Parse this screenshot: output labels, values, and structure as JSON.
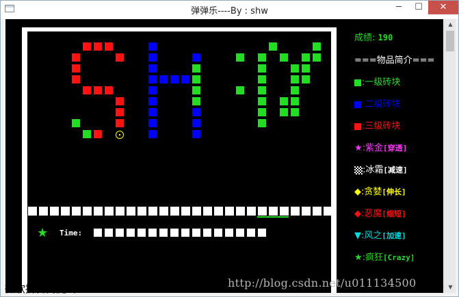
{
  "window": {
    "title": "弹弹乐----By : shw",
    "min_glyph": "─",
    "max_glyph": "☐",
    "close_glyph": "✕"
  },
  "game": {
    "brick_colors": {
      "level1": "#22dd22",
      "level2": "#0000ff",
      "level3": "#ff1111"
    },
    "time_label": "Time:",
    "time_star": "★"
  },
  "sidebar": {
    "score_label": "成绩:",
    "score_value": "190",
    "intro_title": "===物品简介===",
    "items": [
      {
        "icon": "green-square",
        "color": "#22dd22",
        "label": ":一级砖块"
      },
      {
        "icon": "blue-square",
        "color": "#0000ff",
        "label": ":二级砖块"
      },
      {
        "icon": "red-square",
        "color": "#ff1111",
        "label": ":三级砖块"
      },
      {
        "icon": "magenta-star",
        "glyph": "★",
        "color": "#ff33ff",
        "label": ":紫金",
        "tag": "[穿透]"
      },
      {
        "icon": "checker-square",
        "color": "#ffffff",
        "label": ":冰霜",
        "tag": "[减速]"
      },
      {
        "icon": "yellow-diamond",
        "glyph": "◆",
        "color": "#ffff00",
        "label": ":贪婪",
        "tag": "[伸长]"
      },
      {
        "icon": "red-diamond",
        "glyph": "◆",
        "color": "#ff1111",
        "label": ":恶魔",
        "tag": "[缩短]"
      },
      {
        "icon": "cyan-triangle",
        "glyph": "▼",
        "color": "#00dddd",
        "label": ":风之",
        "tag": "[加速]"
      },
      {
        "icon": "green-star",
        "glyph": "★",
        "color": "#22dd22",
        "label": ":疯狂",
        "tag": "[Crazy]"
      }
    ]
  },
  "ime": {
    "text": "微软拼音简捷 半 :"
  },
  "watermark": {
    "text": "http://blog.csdn.net/u011134500"
  }
}
